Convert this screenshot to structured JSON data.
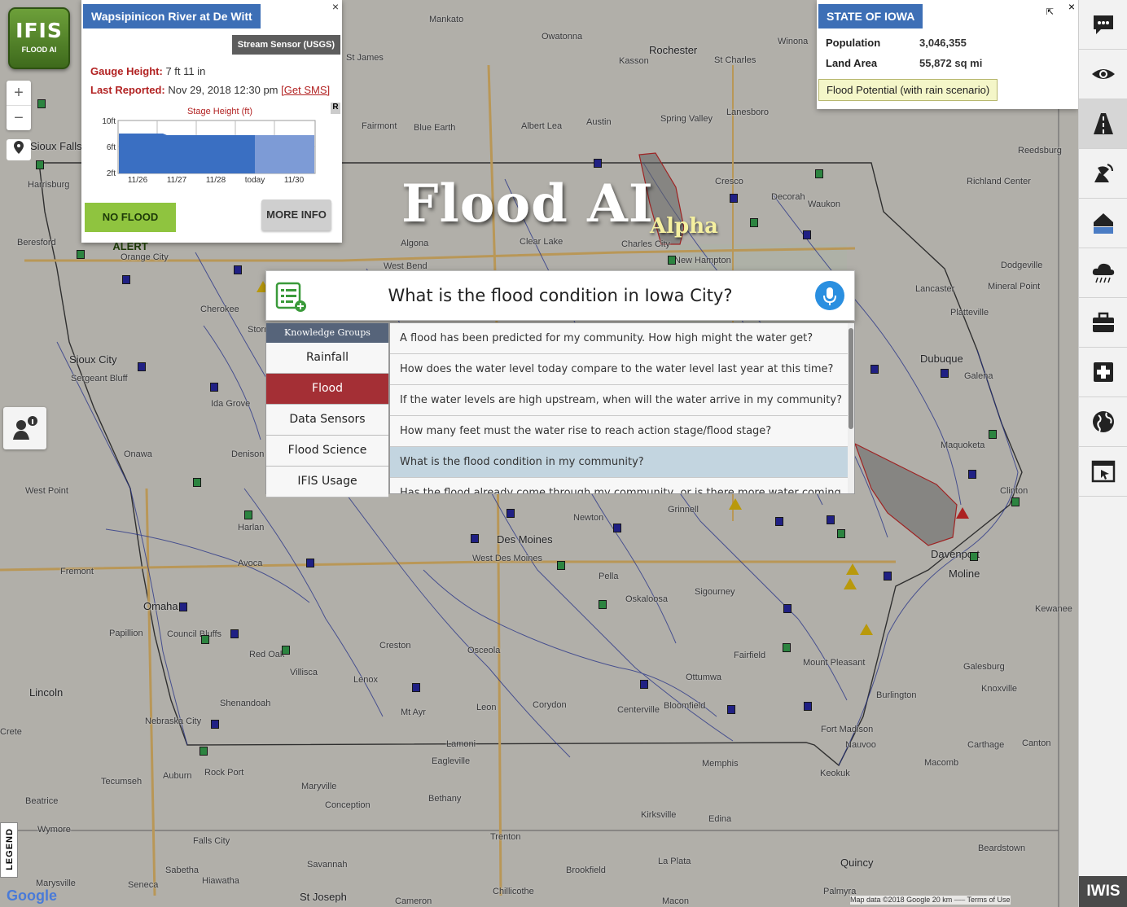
{
  "logo": {
    "line1": "IFIS",
    "line2": "FLOOD AI"
  },
  "zoom": {
    "in": "+",
    "out": "−"
  },
  "legend_label": "LEGEND",
  "sensor_popup": {
    "title": "Wapsipinicon River at De Witt",
    "type": "Stream Sensor (USGS)",
    "gauge_label": "Gauge Height:",
    "gauge_value": "7 ft 11 in",
    "reported_label": "Last Reported:",
    "reported_value": "Nov 29, 2018 12:30 pm",
    "sms_link": "[Get SMS]",
    "chart_title": "Stage Height (ft)",
    "r_badge": "R",
    "y_ticks": [
      "10ft",
      "6ft",
      "2ft"
    ],
    "x_ticks": [
      "11/26",
      "11/27",
      "11/28",
      "today",
      "11/30"
    ],
    "alert": "NO FLOOD ALERT",
    "more_info": "MORE INFO",
    "close": "×"
  },
  "state_panel": {
    "title": "STATE OF IOWA",
    "population_label": "Population",
    "population_value": "3,046,355",
    "area_label": "Land Area",
    "area_value": "55,872 sq mi",
    "flood_potential": "Flood Potential (with rain scenario)",
    "close": "×"
  },
  "flood_ai": {
    "title": "Flood AI",
    "badge": "Alpha",
    "query": "What is the flood condition in Iowa City?",
    "knowledge_header": "Knowledge Groups",
    "knowledge_groups": [
      "Rainfall",
      "Flood",
      "Data Sensors",
      "Flood Science",
      "IFIS Usage"
    ],
    "active_group": "Flood",
    "questions": [
      "A flood has been predicted for my community. How high might the water get?",
      "How does the water level today compare to the water level last year at this time?",
      "If the water levels are high upstream, when will the water arrive in my community?",
      "How many feet must the water rise to reach action stage/flood stage?",
      "What is the flood condition in my community?",
      "Has the flood already come through my community, or is there more water coming"
    ],
    "selected_question": "What is the flood condition in my community?"
  },
  "toolbar": {
    "items": [
      "chat-icon",
      "eye-icon",
      "road-icon",
      "satellite-icon",
      "house-icon",
      "rain-cloud-icon",
      "briefcase-icon",
      "medical-icon",
      "globe-icon",
      "window-icon"
    ],
    "brand": "IWIS"
  },
  "map": {
    "cities": [
      "Mankato",
      "Owatonna",
      "Rochester",
      "Winona",
      "St Charles",
      "Kasson",
      "St James",
      "Fairmont",
      "Blue Earth",
      "Albert Lea",
      "Austin",
      "Spring Valley",
      "Lanesboro",
      "Reedsburg",
      "Richland Center",
      "Waukon",
      "Cresco",
      "Decorah",
      "Clear Lake",
      "Charles City",
      "New Hampton",
      "Algona",
      "West Bend",
      "Orange City",
      "Cherokee",
      "Storm Lake",
      "Sioux City",
      "Sergeant Bluff",
      "Ida Grove",
      "Onawa",
      "Denison",
      "West Point",
      "Harlan",
      "Avoca",
      "Fremont",
      "Omaha",
      "Papillion",
      "Council Bluffs",
      "Red Oak",
      "Villisca",
      "Shenandoah",
      "Nebraska City",
      "Lincoln",
      "Crete",
      "Tecumseh",
      "Auburn",
      "Rock Port",
      "Maryville",
      "Beatrice",
      "Falls City",
      "Wymore",
      "Sabetha",
      "Hiawatha",
      "Seneca",
      "Marysville",
      "Savannah",
      "St Joseph",
      "Chillicothe",
      "Trenton",
      "Brookfield",
      "Cameron",
      "Macon",
      "La Plata",
      "Kirksville",
      "Edina",
      "Bethany",
      "Conception",
      "Eagleville",
      "Lamoni",
      "Memphis",
      "Keokuk",
      "Fort Madison",
      "Nauvoo",
      "Macomb",
      "Carthage",
      "Canton",
      "Galesburg",
      "Knoxville",
      "Burlington",
      "Mount Pleasant",
      "Fairfield",
      "Ottumwa",
      "Oskaloosa",
      "Pella",
      "Sigourney",
      "Newton",
      "Grinnell",
      "West Des Moines",
      "Des Moines",
      "Osceola",
      "Creston",
      "Lenox",
      "Mt Ayr",
      "Leon",
      "Corydon",
      "Centerville",
      "Bloomfield",
      "Davenport",
      "Moline",
      "Clinton",
      "Dubuque",
      "Galena",
      "Maquoketa",
      "Platteville",
      "Lancaster",
      "Dodgeville",
      "Mineral Point",
      "Kewanee",
      "Quincy",
      "Palmyra",
      "Beardstown",
      "Harrisburg",
      "Beresford",
      "Sioux Falls"
    ]
  },
  "attribution": "Map data ©2018 Google   20 km ⎯⎯⎯   Terms of Use",
  "google": "Google"
}
